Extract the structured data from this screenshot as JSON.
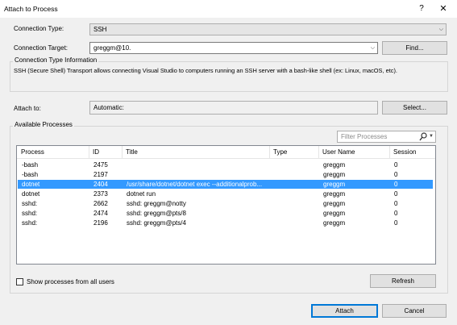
{
  "window": {
    "title": "Attach to Process",
    "help_glyph": "?",
    "close_glyph": "✕"
  },
  "connection": {
    "type_label": "Connection Type:",
    "type_value": "SSH",
    "target_label": "Connection Target:",
    "target_value": "greggm@10.",
    "find_label": "Find..."
  },
  "info": {
    "title": "Connection Type Information",
    "text": "SSH (Secure Shell) Transport allows connecting Visual Studio to computers running an SSH server with a bash-like shell (ex: Linux, macOS, etc)."
  },
  "attach": {
    "label": "Attach to:",
    "value": "Automatic:",
    "select_label": "Select..."
  },
  "processes": {
    "group_title": "Available Processes",
    "filter_placeholder": "Filter Processes",
    "columns": [
      "Process",
      "ID",
      "Title",
      "Type",
      "User Name",
      "Session"
    ],
    "rows": [
      {
        "process": "-bash",
        "id": "2475",
        "title": "",
        "type": "",
        "user": "greggm",
        "session": "0",
        "selected": false
      },
      {
        "process": "-bash",
        "id": "2197",
        "title": "",
        "type": "",
        "user": "greggm",
        "session": "0",
        "selected": false
      },
      {
        "process": "dotnet",
        "id": "2404",
        "title": "/usr/share/dotnet/dotnet exec --additionalprob...",
        "type": "",
        "user": "greggm",
        "session": "0",
        "selected": true
      },
      {
        "process": "dotnet",
        "id": "2373",
        "title": "dotnet run",
        "type": "",
        "user": "greggm",
        "session": "0",
        "selected": false
      },
      {
        "process": "sshd:",
        "id": "2662",
        "title": "sshd: greggm@notty",
        "type": "",
        "user": "greggm",
        "session": "0",
        "selected": false
      },
      {
        "process": "sshd:",
        "id": "2474",
        "title": "sshd: greggm@pts/8",
        "type": "",
        "user": "greggm",
        "session": "0",
        "selected": false
      },
      {
        "process": "sshd:",
        "id": "2196",
        "title": "sshd: greggm@pts/4",
        "type": "",
        "user": "greggm",
        "session": "0",
        "selected": false
      }
    ],
    "show_all_label": "Show processes from all users",
    "show_all_checked": false,
    "refresh_label": "Refresh"
  },
  "footer": {
    "attach_label": "Attach",
    "cancel_label": "Cancel"
  },
  "colors": {
    "selection": "#3399ff",
    "accent": "#0078d7"
  }
}
